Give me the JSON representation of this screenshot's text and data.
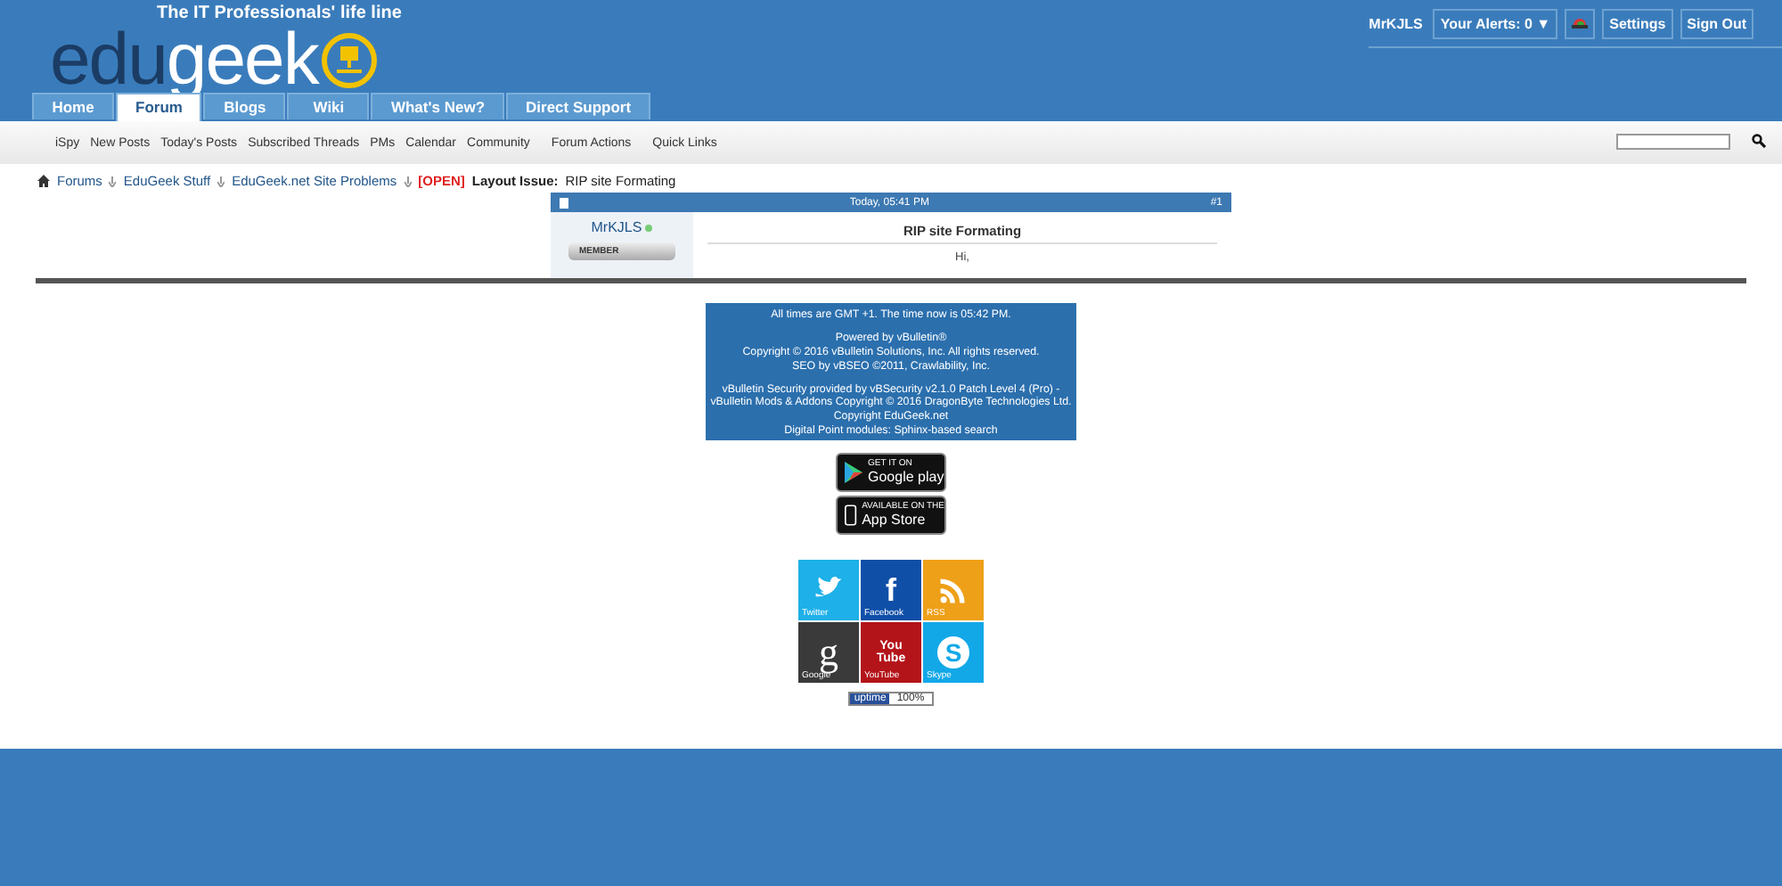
{
  "logo": {
    "tagline": "The IT Professionals' life line",
    "part_1": "edu",
    "part_2": "geek"
  },
  "user_bar": {
    "username": "MrKJLS",
    "alerts": "Your Alerts: 0 ▼",
    "buttons": [
      "Settings",
      "Sign Out"
    ]
  },
  "tabs": [
    {
      "label": "Home",
      "selected": false
    },
    {
      "label": "Forum",
      "selected": true
    },
    {
      "label": "Blogs",
      "selected": false
    },
    {
      "label": "Wiki",
      "selected": false
    },
    {
      "label": "What's New?",
      "selected": false
    },
    {
      "label": "Direct Support",
      "selected": false
    }
  ],
  "sub_nav": [
    {
      "label": "iSpy",
      "dropdown": false
    },
    {
      "label": "New Posts",
      "dropdown": false
    },
    {
      "label": "Today's Posts",
      "dropdown": false
    },
    {
      "label": "Subscribed Threads",
      "dropdown": false
    },
    {
      "label": "PMs",
      "dropdown": false
    },
    {
      "label": "Calendar",
      "dropdown": false
    },
    {
      "label": "Community",
      "dropdown": true
    },
    {
      "label": "Forum Actions",
      "dropdown": true
    },
    {
      "label": "Quick Links",
      "dropdown": false
    }
  ],
  "breadcrumb": {
    "items": [
      "Forums",
      "EduGeek Stuff",
      "EduGeek.net Site Problems"
    ],
    "prefix": "[OPEN]",
    "title": "Layout Issue:",
    "rest": "RIP site Formating"
  },
  "post": {
    "date": "Today, 05:41 PM",
    "number": "#1",
    "author": "MrKJLS",
    "online": true,
    "rank": "MEMBER",
    "title": "RIP site Formating",
    "body": "Hi,"
  },
  "footer": {
    "paragraphs": [
      [
        "All times are GMT +1. The time now is 05:42 PM."
      ],
      [
        "Powered by vBulletin®",
        "Copyright © 2016 vBulletin Solutions, Inc. All rights reserved.",
        "SEO by vBSEO ©2011, Crawlability, Inc."
      ],
      [
        "vBulletin Security provided by vBSecurity v2.1.0 Patch Level 4 (Pro) - vBulletin Mods & Addons Copyright © 2016 DragonByte Technologies Ltd.",
        "Copyright EduGeek.net",
        "Digital Point modules: Sphinx-based search"
      ]
    ]
  },
  "store_badges": [
    {
      "kind": "google",
      "small": "GET IT ON",
      "big": "Google play"
    },
    {
      "kind": "apple",
      "small": "AVAILABLE ON THE",
      "big": "App Store"
    }
  ],
  "social": [
    {
      "kind": "twitter",
      "label": "Twitter",
      "color": "#1eb0e8"
    },
    {
      "kind": "facebook",
      "glyph": "f",
      "label": "Facebook",
      "color": "#0f4fa8"
    },
    {
      "kind": "rss",
      "label": "RSS",
      "color": "#eea018"
    },
    {
      "kind": "google",
      "glyph": "g",
      "label": "Google",
      "color": "#3a3a3a"
    },
    {
      "kind": "youtube",
      "glyph": "You Tube",
      "label": "YouTube",
      "color": "#b3141a"
    },
    {
      "kind": "skype",
      "glyph": "S",
      "label": "Skype",
      "color": "#12a8e8"
    }
  ],
  "uptime": {
    "label": "uptime",
    "value": "100%"
  }
}
